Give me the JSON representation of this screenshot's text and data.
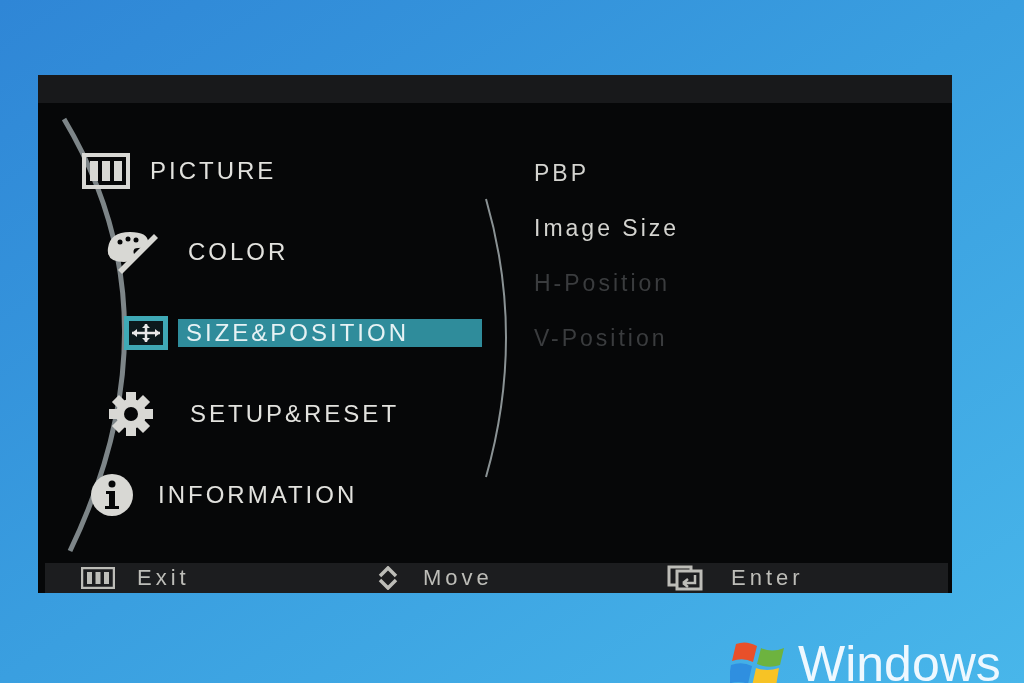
{
  "menu": {
    "items": [
      {
        "label": "PICTURE",
        "selected": false
      },
      {
        "label": "COLOR",
        "selected": false
      },
      {
        "label": "SIZE&POSITION",
        "selected": true
      },
      {
        "label": "SETUP&RESET",
        "selected": false
      },
      {
        "label": "INFORMATION",
        "selected": false
      }
    ],
    "submenu": [
      {
        "label": "PBP",
        "disabled": false
      },
      {
        "label": "Image Size",
        "disabled": false
      },
      {
        "label": "H-Position",
        "disabled": true
      },
      {
        "label": "V-Position",
        "disabled": true
      }
    ]
  },
  "footer": [
    {
      "label": "Exit"
    },
    {
      "label": "Move"
    },
    {
      "label": "Enter"
    }
  ],
  "desktop": {
    "logo_text": "Windows"
  }
}
